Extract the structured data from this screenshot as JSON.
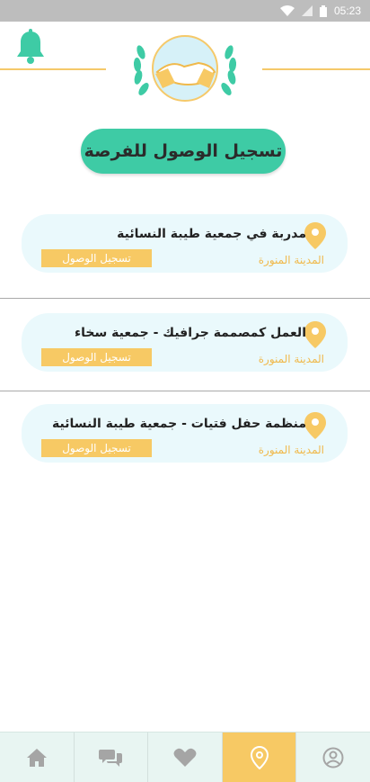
{
  "status_bar": {
    "time": "05:23"
  },
  "page": {
    "title": "تسجيل الوصول للفرصة"
  },
  "opportunities": [
    {
      "title": "مدربة في جمعية طيبة النسائية",
      "city": "المدينة المنورة",
      "button": "تسجيل الوصول"
    },
    {
      "title": "العمل كمصممة جرافيك - جمعية سخاء",
      "city": "المدينة المنورة",
      "button": "تسجيل الوصول"
    },
    {
      "title": "منظمة حفل فتيات - جمعية طيبة النسائية",
      "city": "المدينة المنورة",
      "button": "تسجيل الوصول"
    }
  ],
  "icons": {
    "header": [
      "bell-icon",
      "logo-handshake"
    ],
    "card": "location-pin-icon",
    "nav": [
      "home-icon",
      "chat-icon",
      "heart-icon",
      "checkin-pin-icon",
      "profile-icon"
    ]
  },
  "bottom_nav": {
    "active_index": 3
  },
  "colors": {
    "primary": "#3ecba5",
    "accent": "#f7c964",
    "card_bg": "#eaf9fc",
    "city_text": "#f0b94b",
    "nav_bg": "#e8f5f2",
    "status_bar": "#bdbdbd"
  }
}
